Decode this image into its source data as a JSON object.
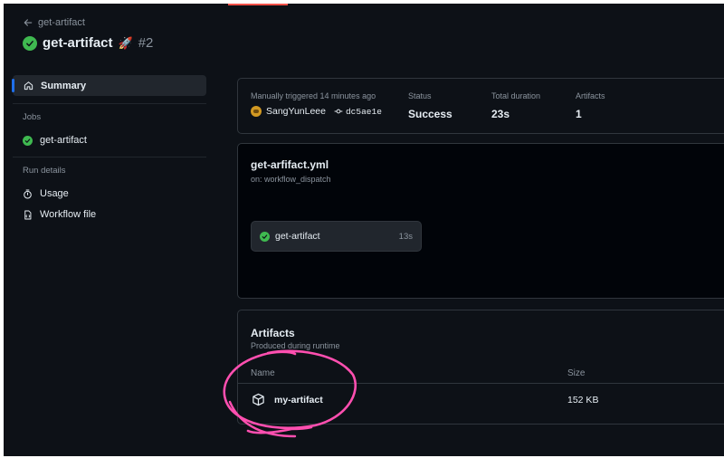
{
  "header": {
    "back_label": "get-artifact",
    "title": "get-artifact",
    "emoji": "🚀",
    "run_number": "#2"
  },
  "sidebar": {
    "summary_label": "Summary",
    "jobs_heading": "Jobs",
    "jobs": [
      {
        "label": "get-artifact",
        "status": "success"
      }
    ],
    "run_details_heading": "Run details",
    "run_details": [
      {
        "label": "Usage",
        "icon": "stopwatch-icon"
      },
      {
        "label": "Workflow file",
        "icon": "file-code-icon"
      }
    ]
  },
  "summary": {
    "trigger_label": "Manually triggered 14 minutes ago",
    "user": "SangYunLeee",
    "commit": "dc5ae1e",
    "status_label": "Status",
    "status_value": "Success",
    "duration_label": "Total duration",
    "duration_value": "23s",
    "artifacts_label": "Artifacts",
    "artifacts_value": "1"
  },
  "workflow": {
    "file": "get-arfifact.yml",
    "trigger": "on: workflow_dispatch",
    "job_name": "get-artifact",
    "job_duration": "13s"
  },
  "artifacts": {
    "title": "Artifacts",
    "subtitle": "Produced during runtime",
    "col_name": "Name",
    "col_size": "Size",
    "rows": [
      {
        "name": "my-artifact",
        "size": "152 KB"
      }
    ]
  },
  "colors": {
    "background": "#0d1117",
    "success": "#3fb950",
    "accent": "#1f6feb",
    "annotation": "#ff4fb0"
  }
}
